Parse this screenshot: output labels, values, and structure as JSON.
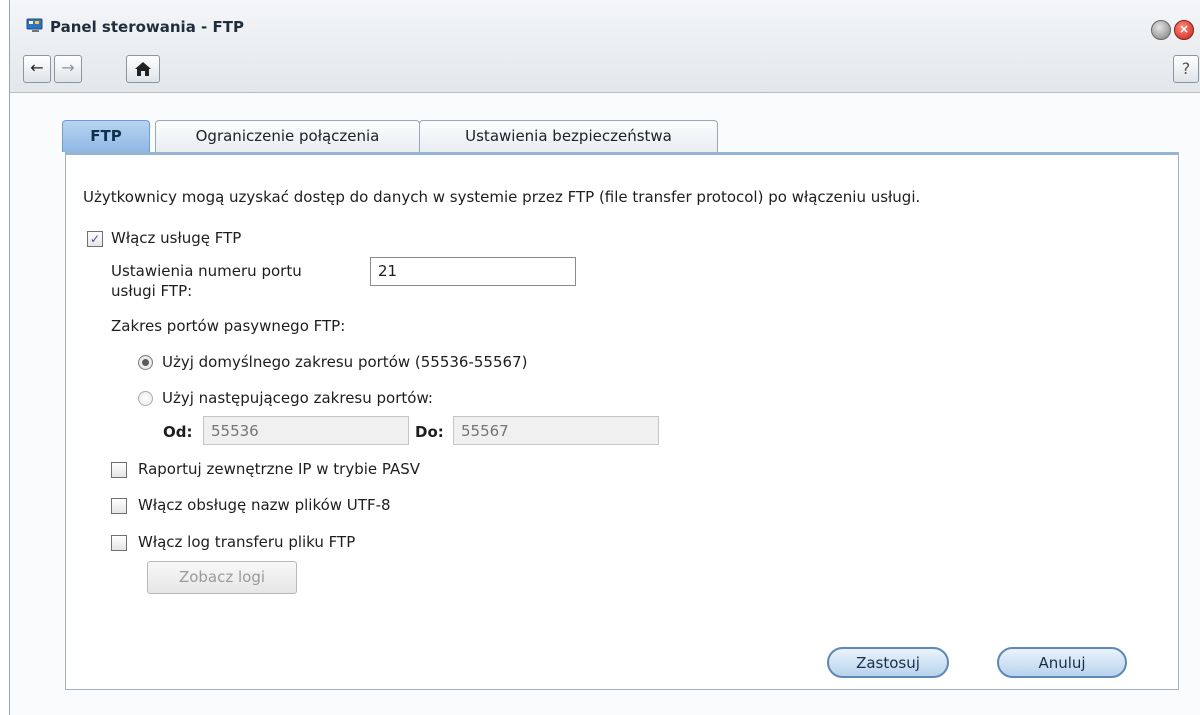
{
  "window": {
    "title": "Panel sterowania - FTP",
    "icon": "control-panel-icon",
    "accent": "#6f9dcc"
  },
  "toolbar": {
    "back_icon": "arrow-left-icon",
    "forward_icon": "arrow-right-icon",
    "home_icon": "home-icon",
    "help": "?"
  },
  "tabs": [
    {
      "label": "FTP"
    },
    {
      "label": "Ograniczenie połączenia"
    },
    {
      "label": "Ustawienia bezpieczeństwa"
    }
  ],
  "content": {
    "description": "Użytkownicy mogą uzyskać dostęp do danych w systemie przez FTP (file transfer protocol) po włączeniu usługi.",
    "enable_ftp": {
      "label": "Włącz usługę FTP",
      "checked": true
    },
    "port": {
      "label_line1": "Ustawienia numeru portu",
      "label_line2": "usługi FTP:",
      "value": "21"
    },
    "passive_range": {
      "label": "Zakres portów pasywnego FTP:",
      "default_option": "Użyj domyślnego zakresu portów (55536-55567)",
      "custom_option": "Użyj następującego zakresu portów:",
      "from_label": "Od:",
      "from_placeholder": "55536",
      "to_label": "Do:",
      "to_placeholder": "55567"
    },
    "report_ip": {
      "label": "Raportuj zewnętrzne IP w trybie PASV",
      "checked": false
    },
    "utf8": {
      "label": "Włącz obsługę nazw plików UTF-8",
      "checked": false
    },
    "transfer_log": {
      "label": "Włącz log transferu pliku FTP",
      "checked": false
    },
    "view_logs": "Zobacz logi"
  },
  "footer": {
    "apply": "Zastosuj",
    "cancel": "Anuluj"
  }
}
